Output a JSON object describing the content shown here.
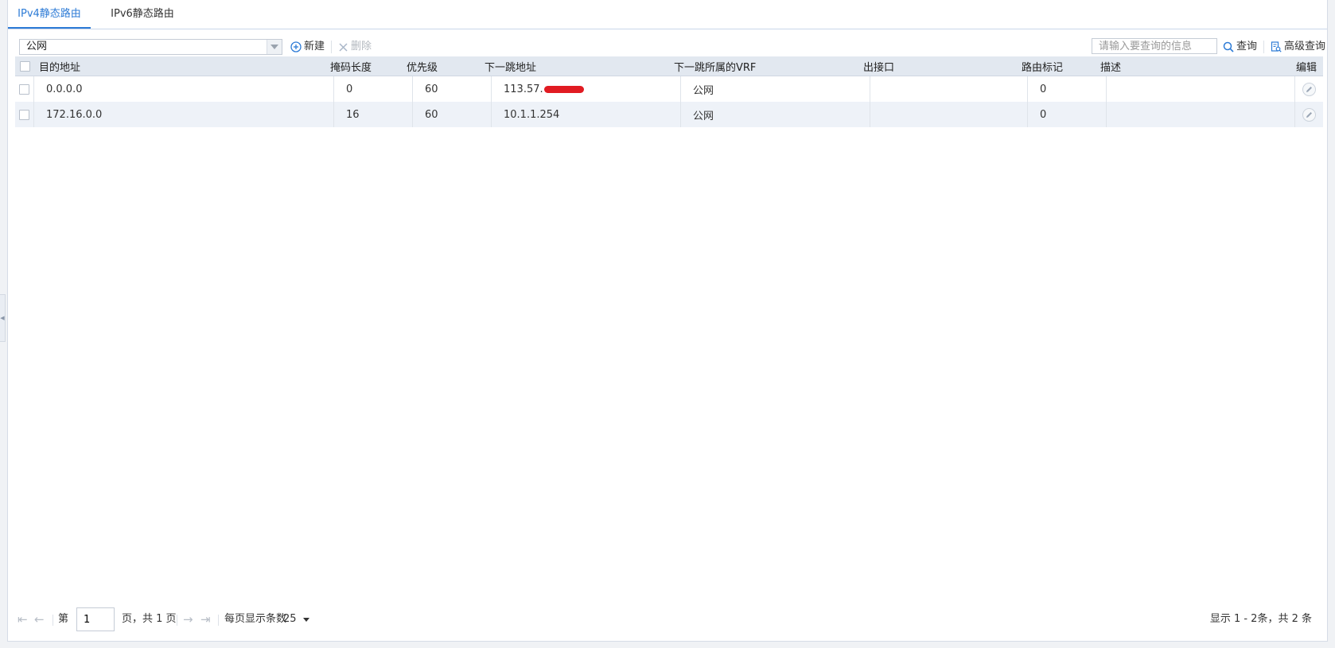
{
  "tabs": [
    {
      "label": "IPv4静态路由",
      "active": true
    },
    {
      "label": "IPv6静态路由",
      "active": false
    }
  ],
  "toolbar": {
    "vrf_value": "公网",
    "new_label": "新建",
    "delete_label": "删除",
    "search_placeholder": "请输入要查询的信息",
    "query_label": "查询",
    "advanced_query_label": "高级查询"
  },
  "table": {
    "columns": {
      "dest": "目的地址",
      "mask": "掩码长度",
      "priority": "优先级",
      "nexthop": "下一跳地址",
      "vrf": "下一跳所属的VRF",
      "iface": "出接口",
      "tag": "路由标记",
      "desc": "描述",
      "edit": "编辑"
    },
    "rows": [
      {
        "dest": "0.0.0.0",
        "mask": "0",
        "priority": "60",
        "nexthop": "113.57.",
        "vrf": "公网",
        "iface": "",
        "tag": "0",
        "desc": ""
      },
      {
        "dest": "172.16.0.0",
        "mask": "16",
        "priority": "60",
        "nexthop": "10.1.1.254",
        "vrf": "公网",
        "iface": "",
        "tag": "0",
        "desc": ""
      }
    ]
  },
  "pager": {
    "page_prefix": "第",
    "current_page": "1",
    "page_suffix": "页，共 1 页",
    "page_size_label": "每页显示条数",
    "page_size": "25",
    "summary": "显示 1 - 2条，共 2 条"
  },
  "colors": {
    "accent": "#2d7bd6",
    "header_bg": "#e2e8f0",
    "row_alt_bg": "#eef2f8",
    "redaction": "#e11b22"
  }
}
